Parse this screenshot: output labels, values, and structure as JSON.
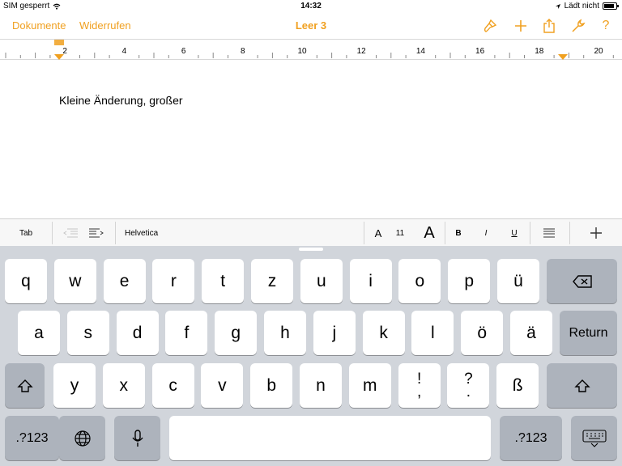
{
  "status": {
    "carrier": "SIM gesperrt",
    "time": "14:32",
    "charging": "Lädt nicht",
    "battery_level": 0.85
  },
  "nav": {
    "documents": "Dokumente",
    "undo": "Widerrufen",
    "title": "Leer 3",
    "icons": [
      "paintbrush-icon",
      "plus-icon",
      "share-icon",
      "wrench-icon",
      "help-icon"
    ],
    "help": "?"
  },
  "ruler": {
    "labels": [
      "2",
      "4",
      "6",
      "8",
      "10",
      "12",
      "14",
      "16",
      "18",
      "20"
    ]
  },
  "document": {
    "text": "Kleine Änderung, großer"
  },
  "format_bar": {
    "tab": "Tab",
    "font": "Helvetica",
    "font_small": "A",
    "font_size": "11",
    "font_large": "A",
    "bold": "B",
    "italic": "I",
    "underline": "U"
  },
  "keyboard": {
    "row1": [
      "q",
      "w",
      "e",
      "r",
      "t",
      "z",
      "u",
      "i",
      "o",
      "p",
      "ü"
    ],
    "row2": [
      "a",
      "s",
      "d",
      "f",
      "g",
      "h",
      "j",
      "k",
      "l",
      "ö",
      "ä"
    ],
    "return": "Return",
    "row3": [
      "y",
      "x",
      "c",
      "v",
      "b",
      "n",
      "m",
      "ß"
    ],
    "row3_dual": [
      [
        "!",
        ","
      ],
      [
        "?",
        "."
      ]
    ],
    "numbers": ".?123",
    "accent_color": "#f0a020"
  }
}
